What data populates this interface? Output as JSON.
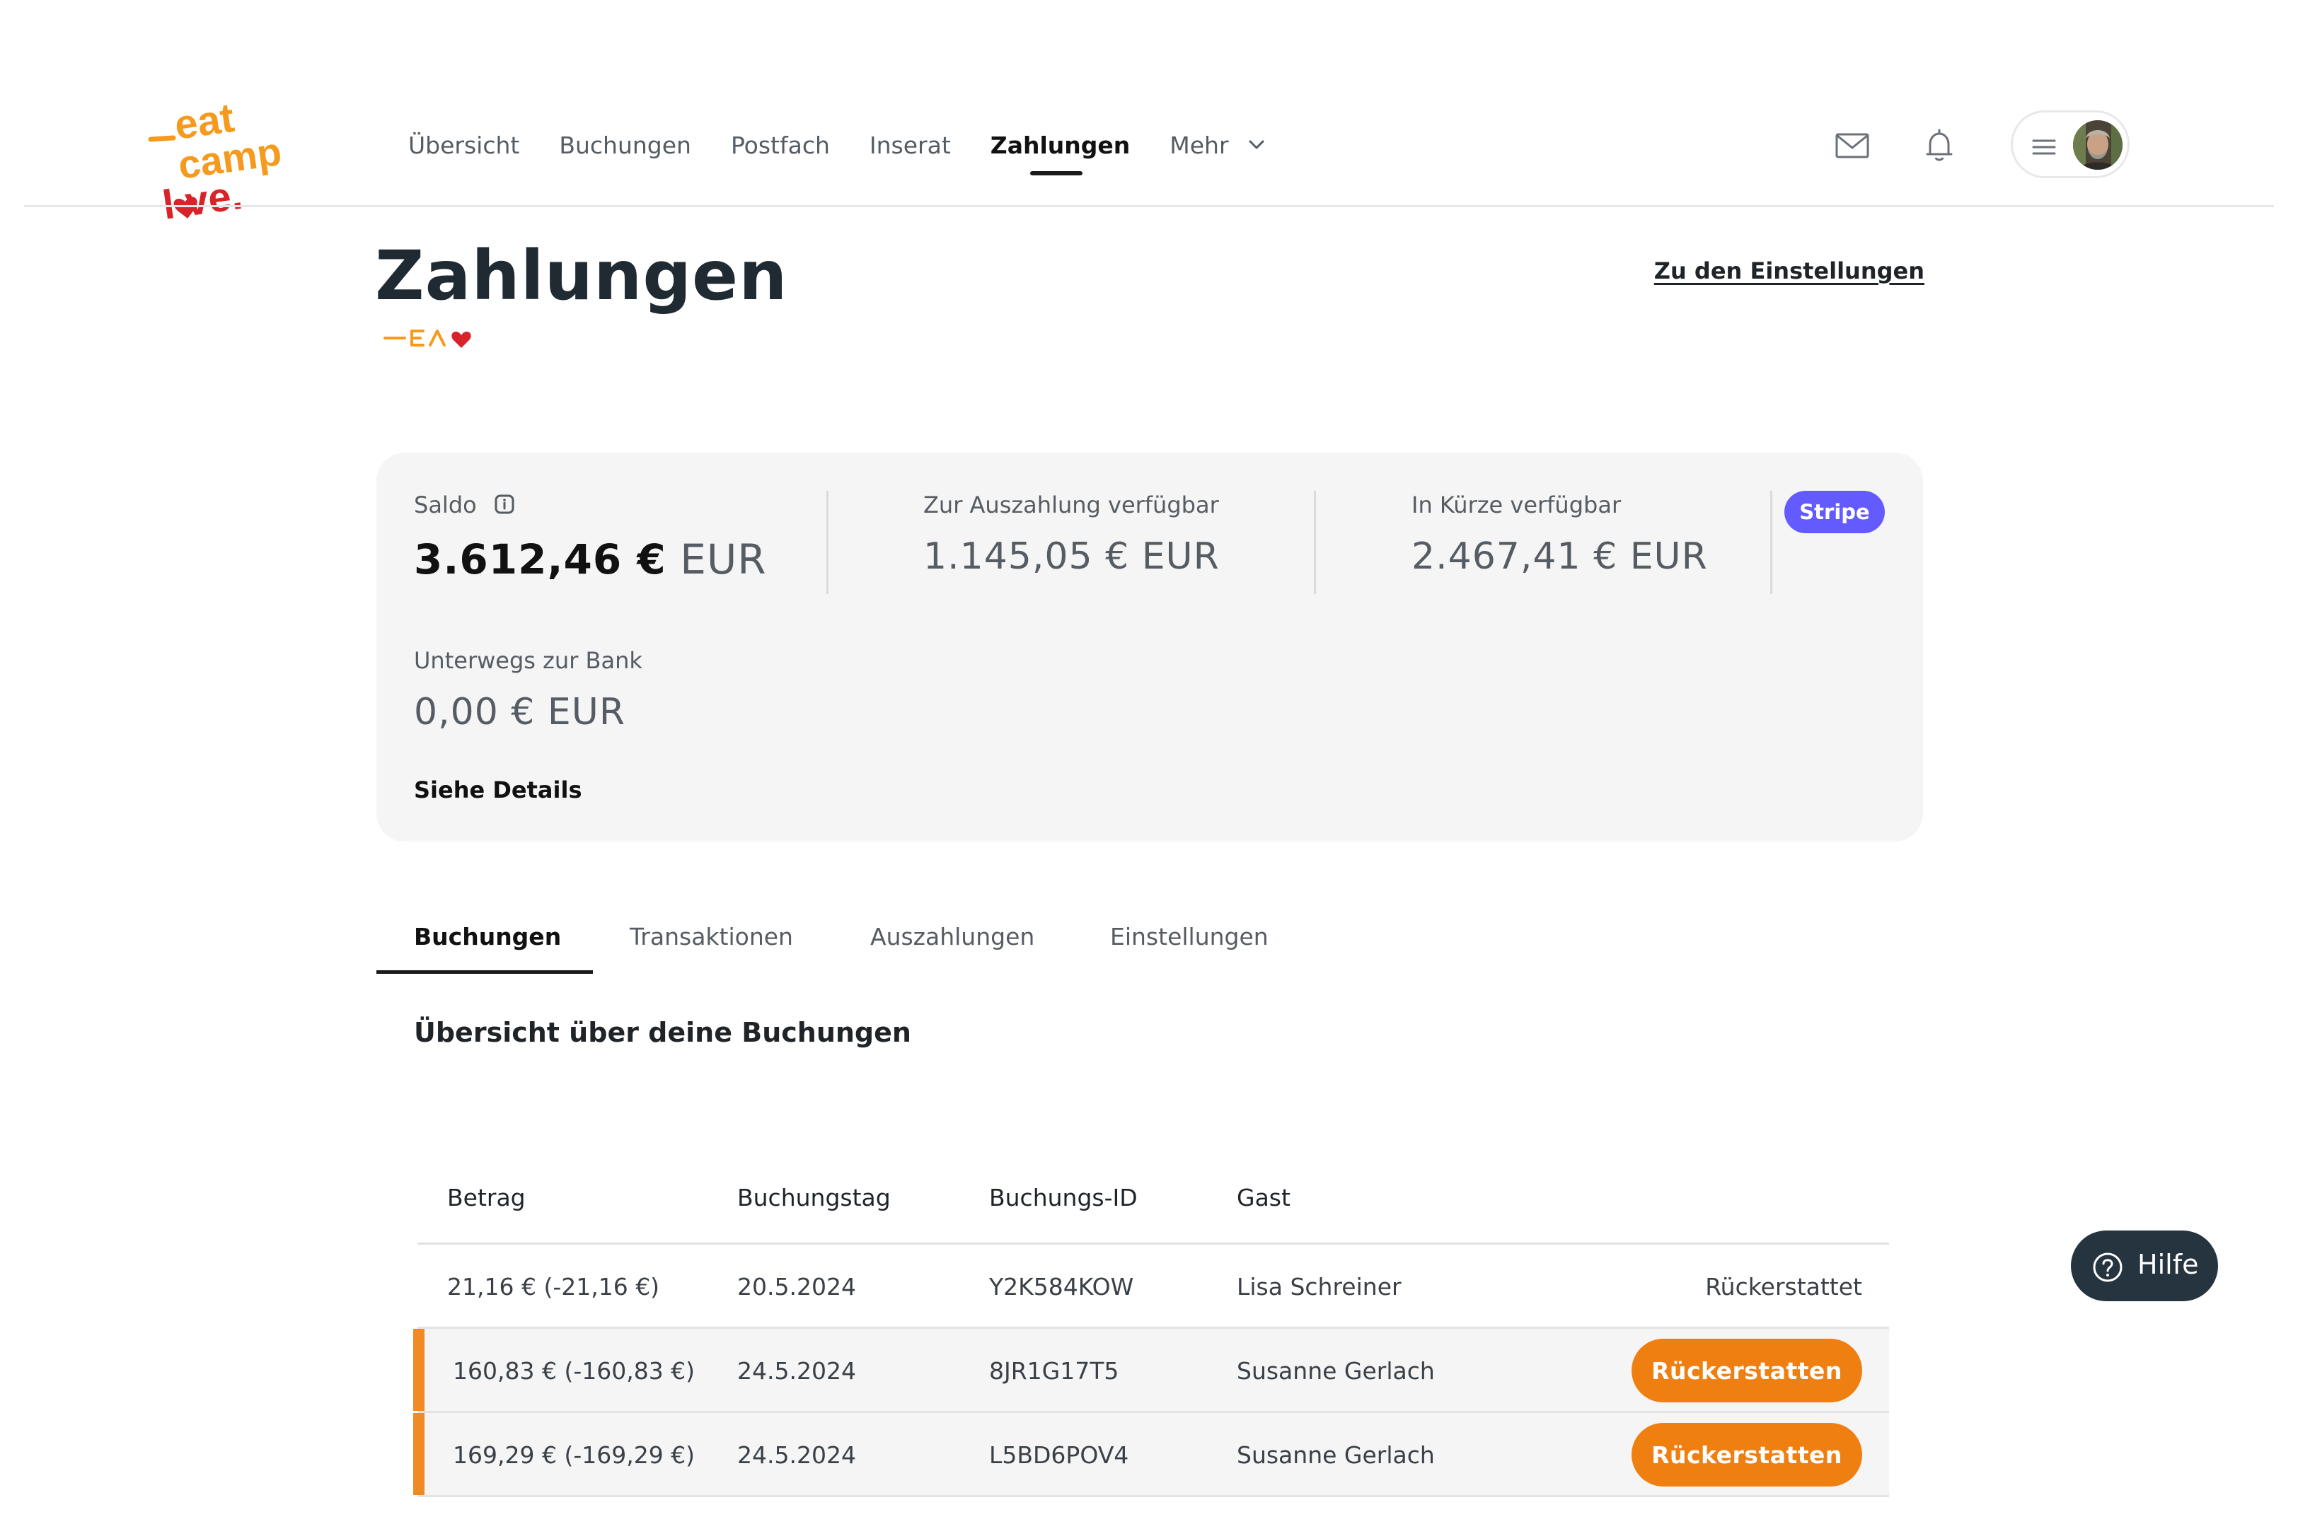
{
  "nav": {
    "items": [
      {
        "label": "Übersicht",
        "active": false
      },
      {
        "label": "Buchungen",
        "active": false
      },
      {
        "label": "Postfach",
        "active": false
      },
      {
        "label": "Inserat",
        "active": false
      },
      {
        "label": "Zahlungen",
        "active": true
      },
      {
        "label": "Mehr",
        "active": false
      }
    ]
  },
  "header_icons": [
    "mail-icon",
    "bell-icon",
    "hamburger-icon",
    "avatar"
  ],
  "logo": {
    "alt": "eat camp love."
  },
  "page": {
    "title": "Zahlungen",
    "settings_link": "Zu den Einstellungen"
  },
  "balance": {
    "saldo_label": "Saldo",
    "saldo_amount": "3.612,46 €",
    "saldo_currency": "EUR",
    "payout_label": "Zur Auszahlung verfügbar",
    "payout_value": "1.145,05 € EUR",
    "soon_label": "In Kürze verfügbar",
    "soon_value": "2.467,41 € EUR",
    "transit_label": "Unterwegs zur Bank",
    "transit_value": "0,00 € EUR",
    "details_link": "Siehe Details",
    "badge": "Stripe"
  },
  "tabs": [
    {
      "label": "Buchungen",
      "active": true
    },
    {
      "label": "Transaktionen",
      "active": false
    },
    {
      "label": "Auszahlungen",
      "active": false
    },
    {
      "label": "Einstellungen",
      "active": false
    }
  ],
  "section_title": "Übersicht über deine Buchungen",
  "table": {
    "columns": [
      "Betrag",
      "Buchungstag",
      "Buchungs-ID",
      "Gast"
    ],
    "rows": [
      {
        "amount": "21,16 € (-21,16 €)",
        "date": "20.5.2024",
        "id": "Y2K584KOW",
        "guest": "Lisa Schreiner",
        "status": "Rückerstattet"
      },
      {
        "amount": "160,83 € (-160,83 €)",
        "date": "24.5.2024",
        "id": "8JR1G17T5",
        "guest": "Susanne Gerlach",
        "action": "Rückerstatten"
      },
      {
        "amount": "169,29 € (-169,29 €)",
        "date": "24.5.2024",
        "id": "L5BD6POV4",
        "guest": "Susanne Gerlach",
        "action": "Rückerstatten"
      }
    ]
  },
  "help": {
    "label": "Hilfe"
  },
  "colors": {
    "accent_orange": "#f07f12",
    "stripe_purple": "#635bff",
    "help_dark": "#263440"
  }
}
